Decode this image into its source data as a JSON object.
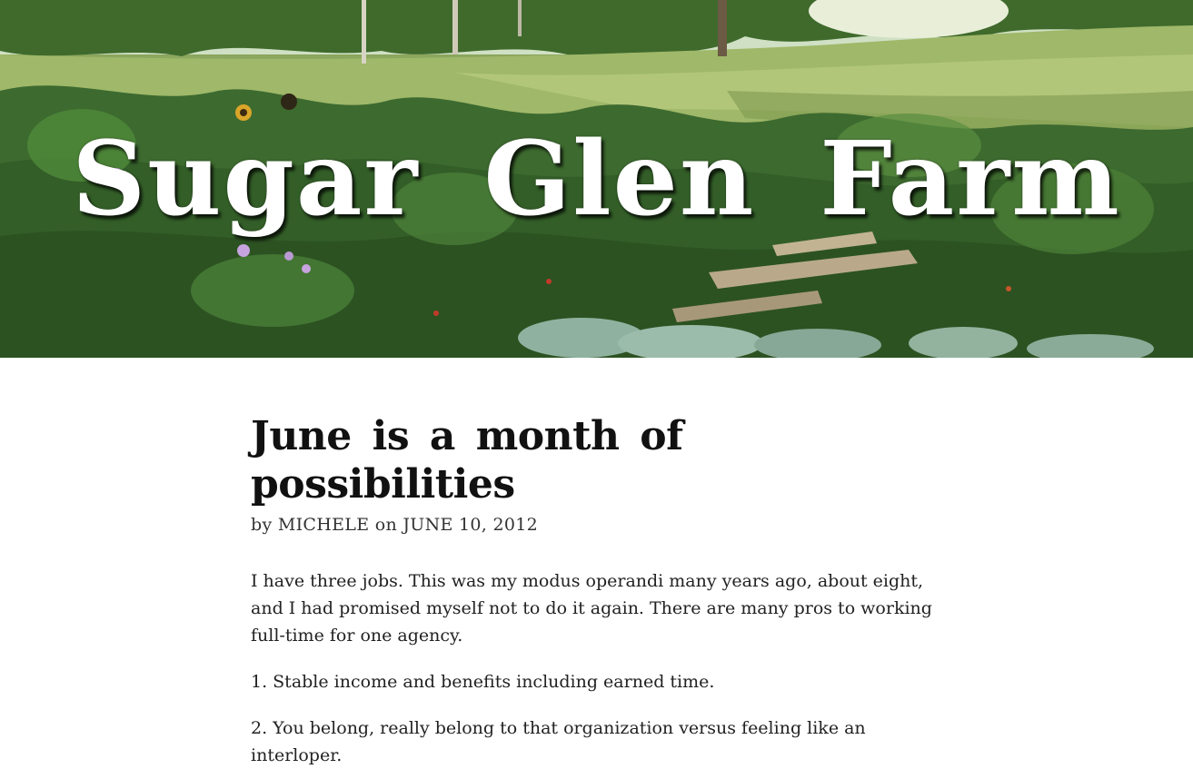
{
  "site": {
    "title": "Sugar Glen Farm"
  },
  "post": {
    "title": "June is a month of possibilities",
    "byline_prefix": "by",
    "author": "MICHELE",
    "byline_on": "on",
    "date": "JUNE 10, 2012",
    "paragraphs": [
      "I have three jobs. This was my modus operandi many years ago, about eight, and I had promised myself not to do it again. There are many pros to working full-time for one agency.",
      "1. Stable income and benefits including earned time.",
      "2. You belong, really belong to that organization versus feeling like an interloper."
    ]
  },
  "colors": {
    "title_text": "#ffffff",
    "body_text": "#222222",
    "background": "#ffffff"
  }
}
